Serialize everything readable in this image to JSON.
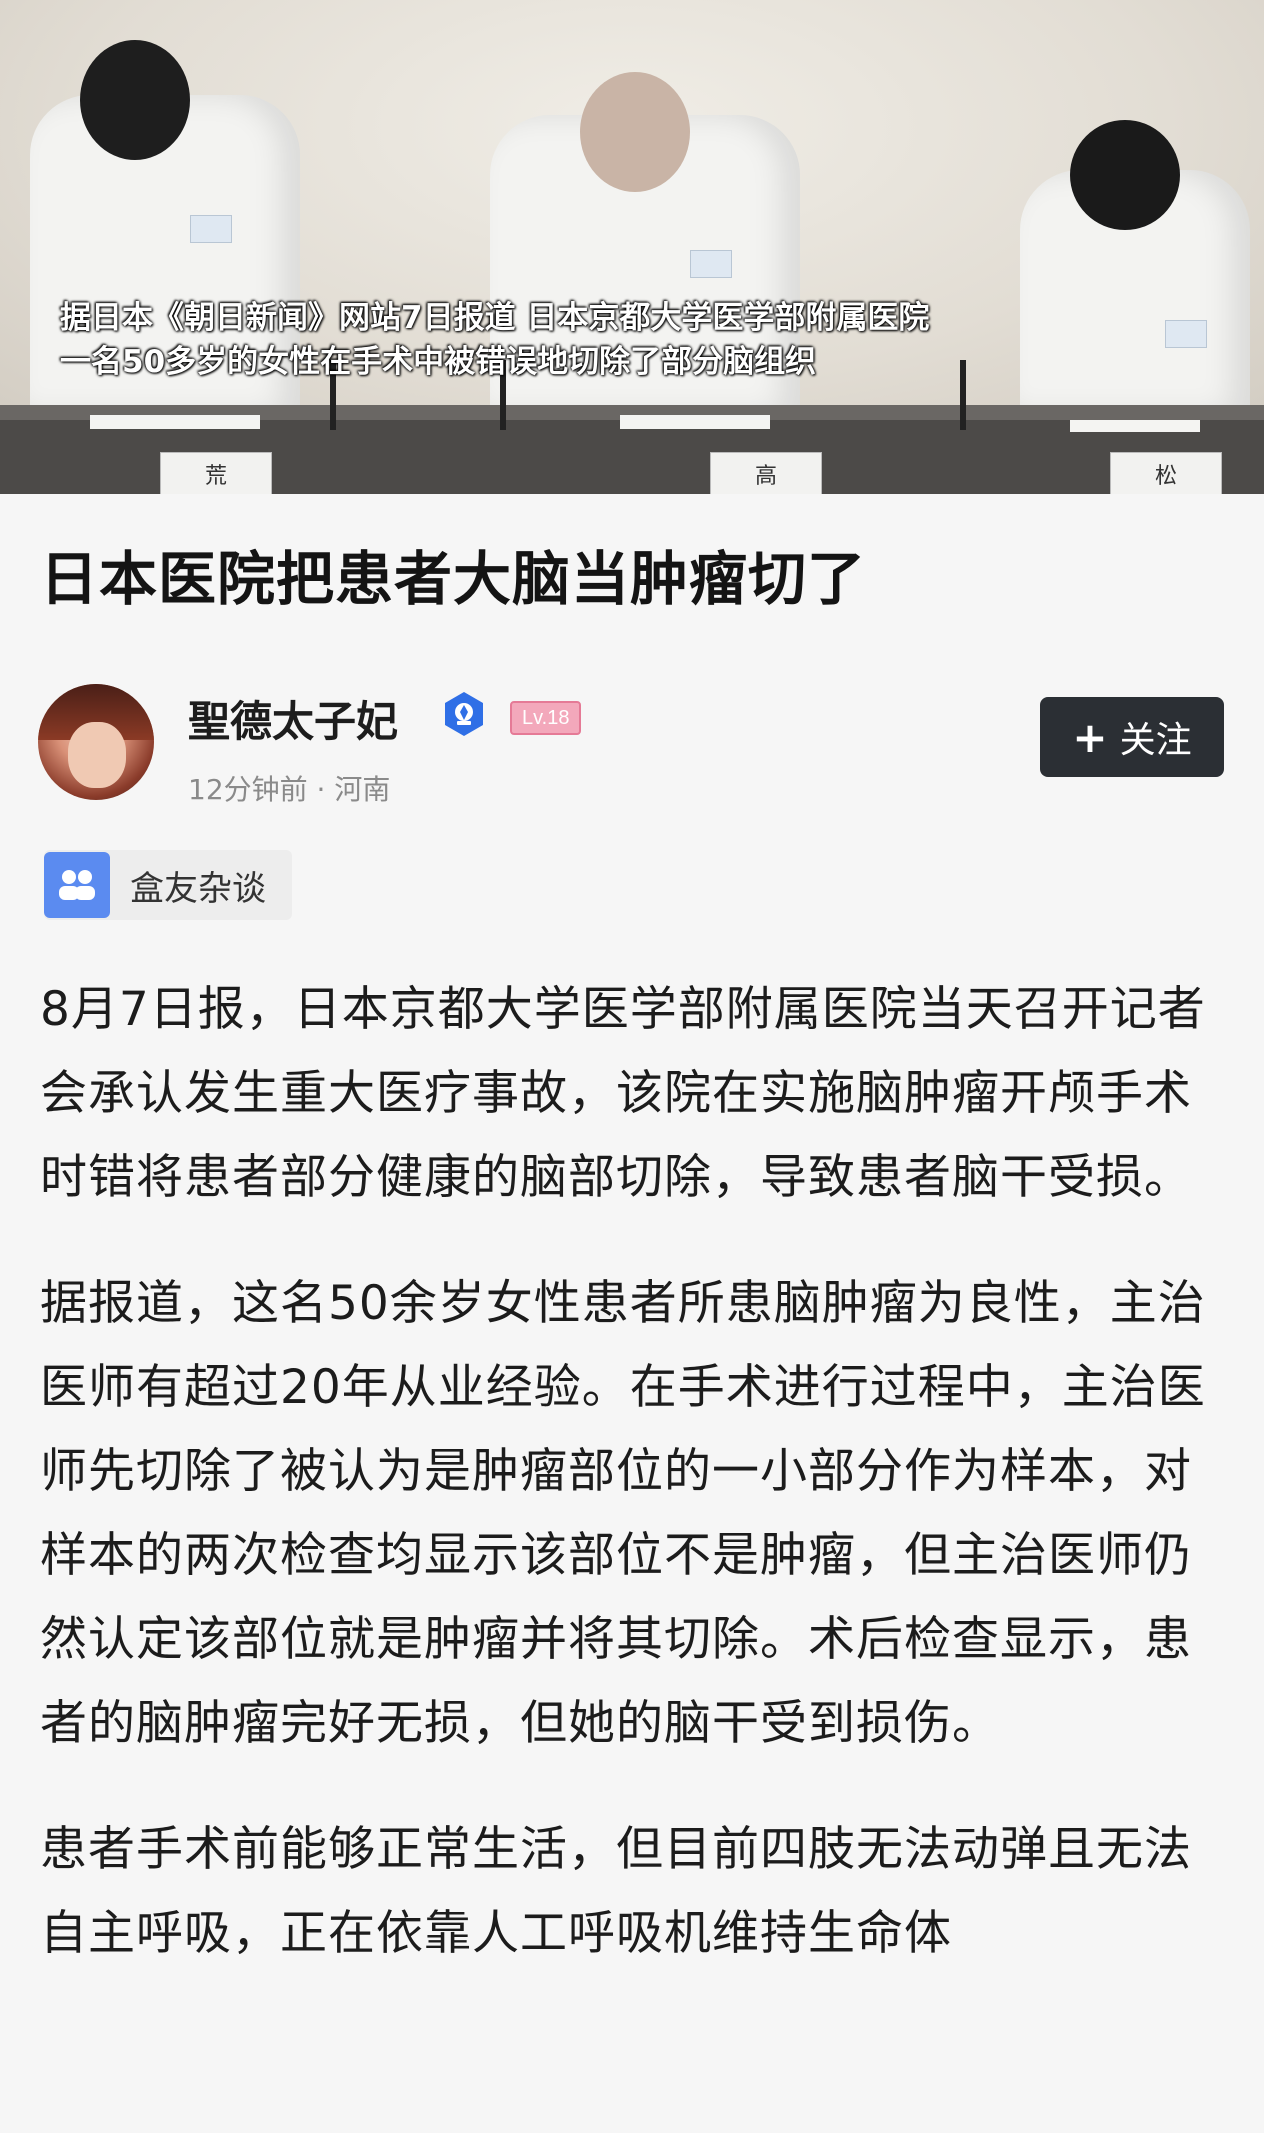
{
  "hero": {
    "caption_line1": "据日本《朝日新闻》网站7日报道 日本京都大学医学部附属医院",
    "caption_line2": "一名50多岁的女性在手术中被错误地切除了部分脑组织",
    "nameplates": [
      "荒",
      "高",
      "松"
    ]
  },
  "post": {
    "title": "日本医院把患者大脑当肿瘤切了",
    "author": {
      "name": "聖德太子妃",
      "level": "Lv.18",
      "meta": "12分钟前 · 河南",
      "follow_label": "关注",
      "verified_icon": "verified-pen-badge-icon"
    },
    "topic": {
      "label": "盒友杂谈",
      "icon": "group-chat-icon",
      "icon_color": "#5b8bf0"
    },
    "paragraphs": [
      "8月7日报，日本京都大学医学部附属医院当天召开记者会承认发生重大医疗事故，该院在实施脑肿瘤开颅手术时错将患者部分健康的脑部切除，导致患者脑干受损。",
      "据报道，这名50余岁女性患者所患脑肿瘤为良性，主治医师有超过20年从业经验。在手术进行过程中，主治医师先切除了被认为是肿瘤部位的一小部分作为样本，对样本的两次检查均显示该部位不是肿瘤，但主治医师仍然认定该部位就是肿瘤并将其切除。术后检查显示，患者的脑肿瘤完好无损，但她的脑干受到损伤。",
      "患者手术前能够正常生活，但目前四肢无法动弹且无法自主呼吸，正在依靠人工呼吸机维持生命体"
    ]
  },
  "colors": {
    "follow_bg": "#2b2f34",
    "level_bg": "#f3a8bb",
    "verified_blue": "#2f6fe6"
  }
}
